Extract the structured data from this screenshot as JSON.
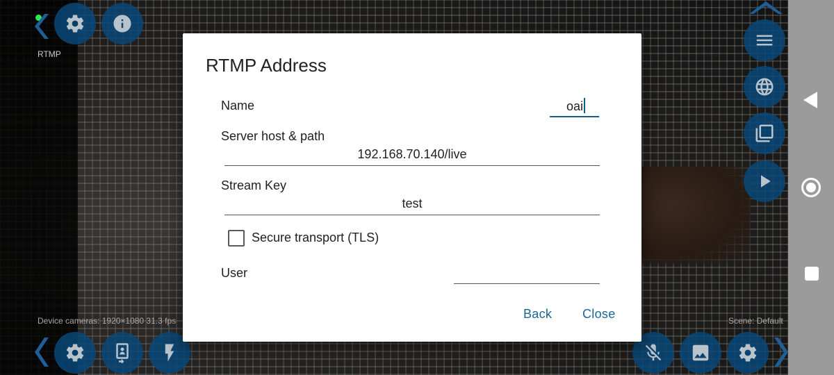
{
  "overlay": {
    "stream_name": "RTMP",
    "status_left": "Device cameras: 1920×1080  31.3 fps",
    "status_right": "Scene:  Default",
    "top_left_icons": [
      "chevron-left-icon",
      "gear-icon",
      "info-icon"
    ],
    "right_icons": [
      "chevron-up-icon",
      "menu-icon",
      "globe-icon",
      "layers-icon",
      "play-icon"
    ],
    "bottom_icons": [
      "chevron-left-icon",
      "gear-icon",
      "portrait-swap-icon",
      "flash-icon",
      "mic-off-icon",
      "image-icon",
      "gear-icon",
      "chevron-right-icon"
    ],
    "accent_color": "#0a4f82",
    "live_dot_color": "#2ee65a"
  },
  "dialog": {
    "title": "RTMP Address",
    "name_label": "Name",
    "name_value": "oai",
    "server_label": "Server host & path",
    "server_value": "192.168.70.140/live",
    "stream_key_label": "Stream Key",
    "stream_key_value": "test",
    "tls_label": "Secure transport (TLS)",
    "tls_checked": false,
    "user_label": "User",
    "user_value": "",
    "back_label": "Back",
    "close_label": "Close",
    "button_color": "#1c6493"
  },
  "system_nav": [
    "back-icon",
    "home-icon",
    "recents-icon"
  ]
}
